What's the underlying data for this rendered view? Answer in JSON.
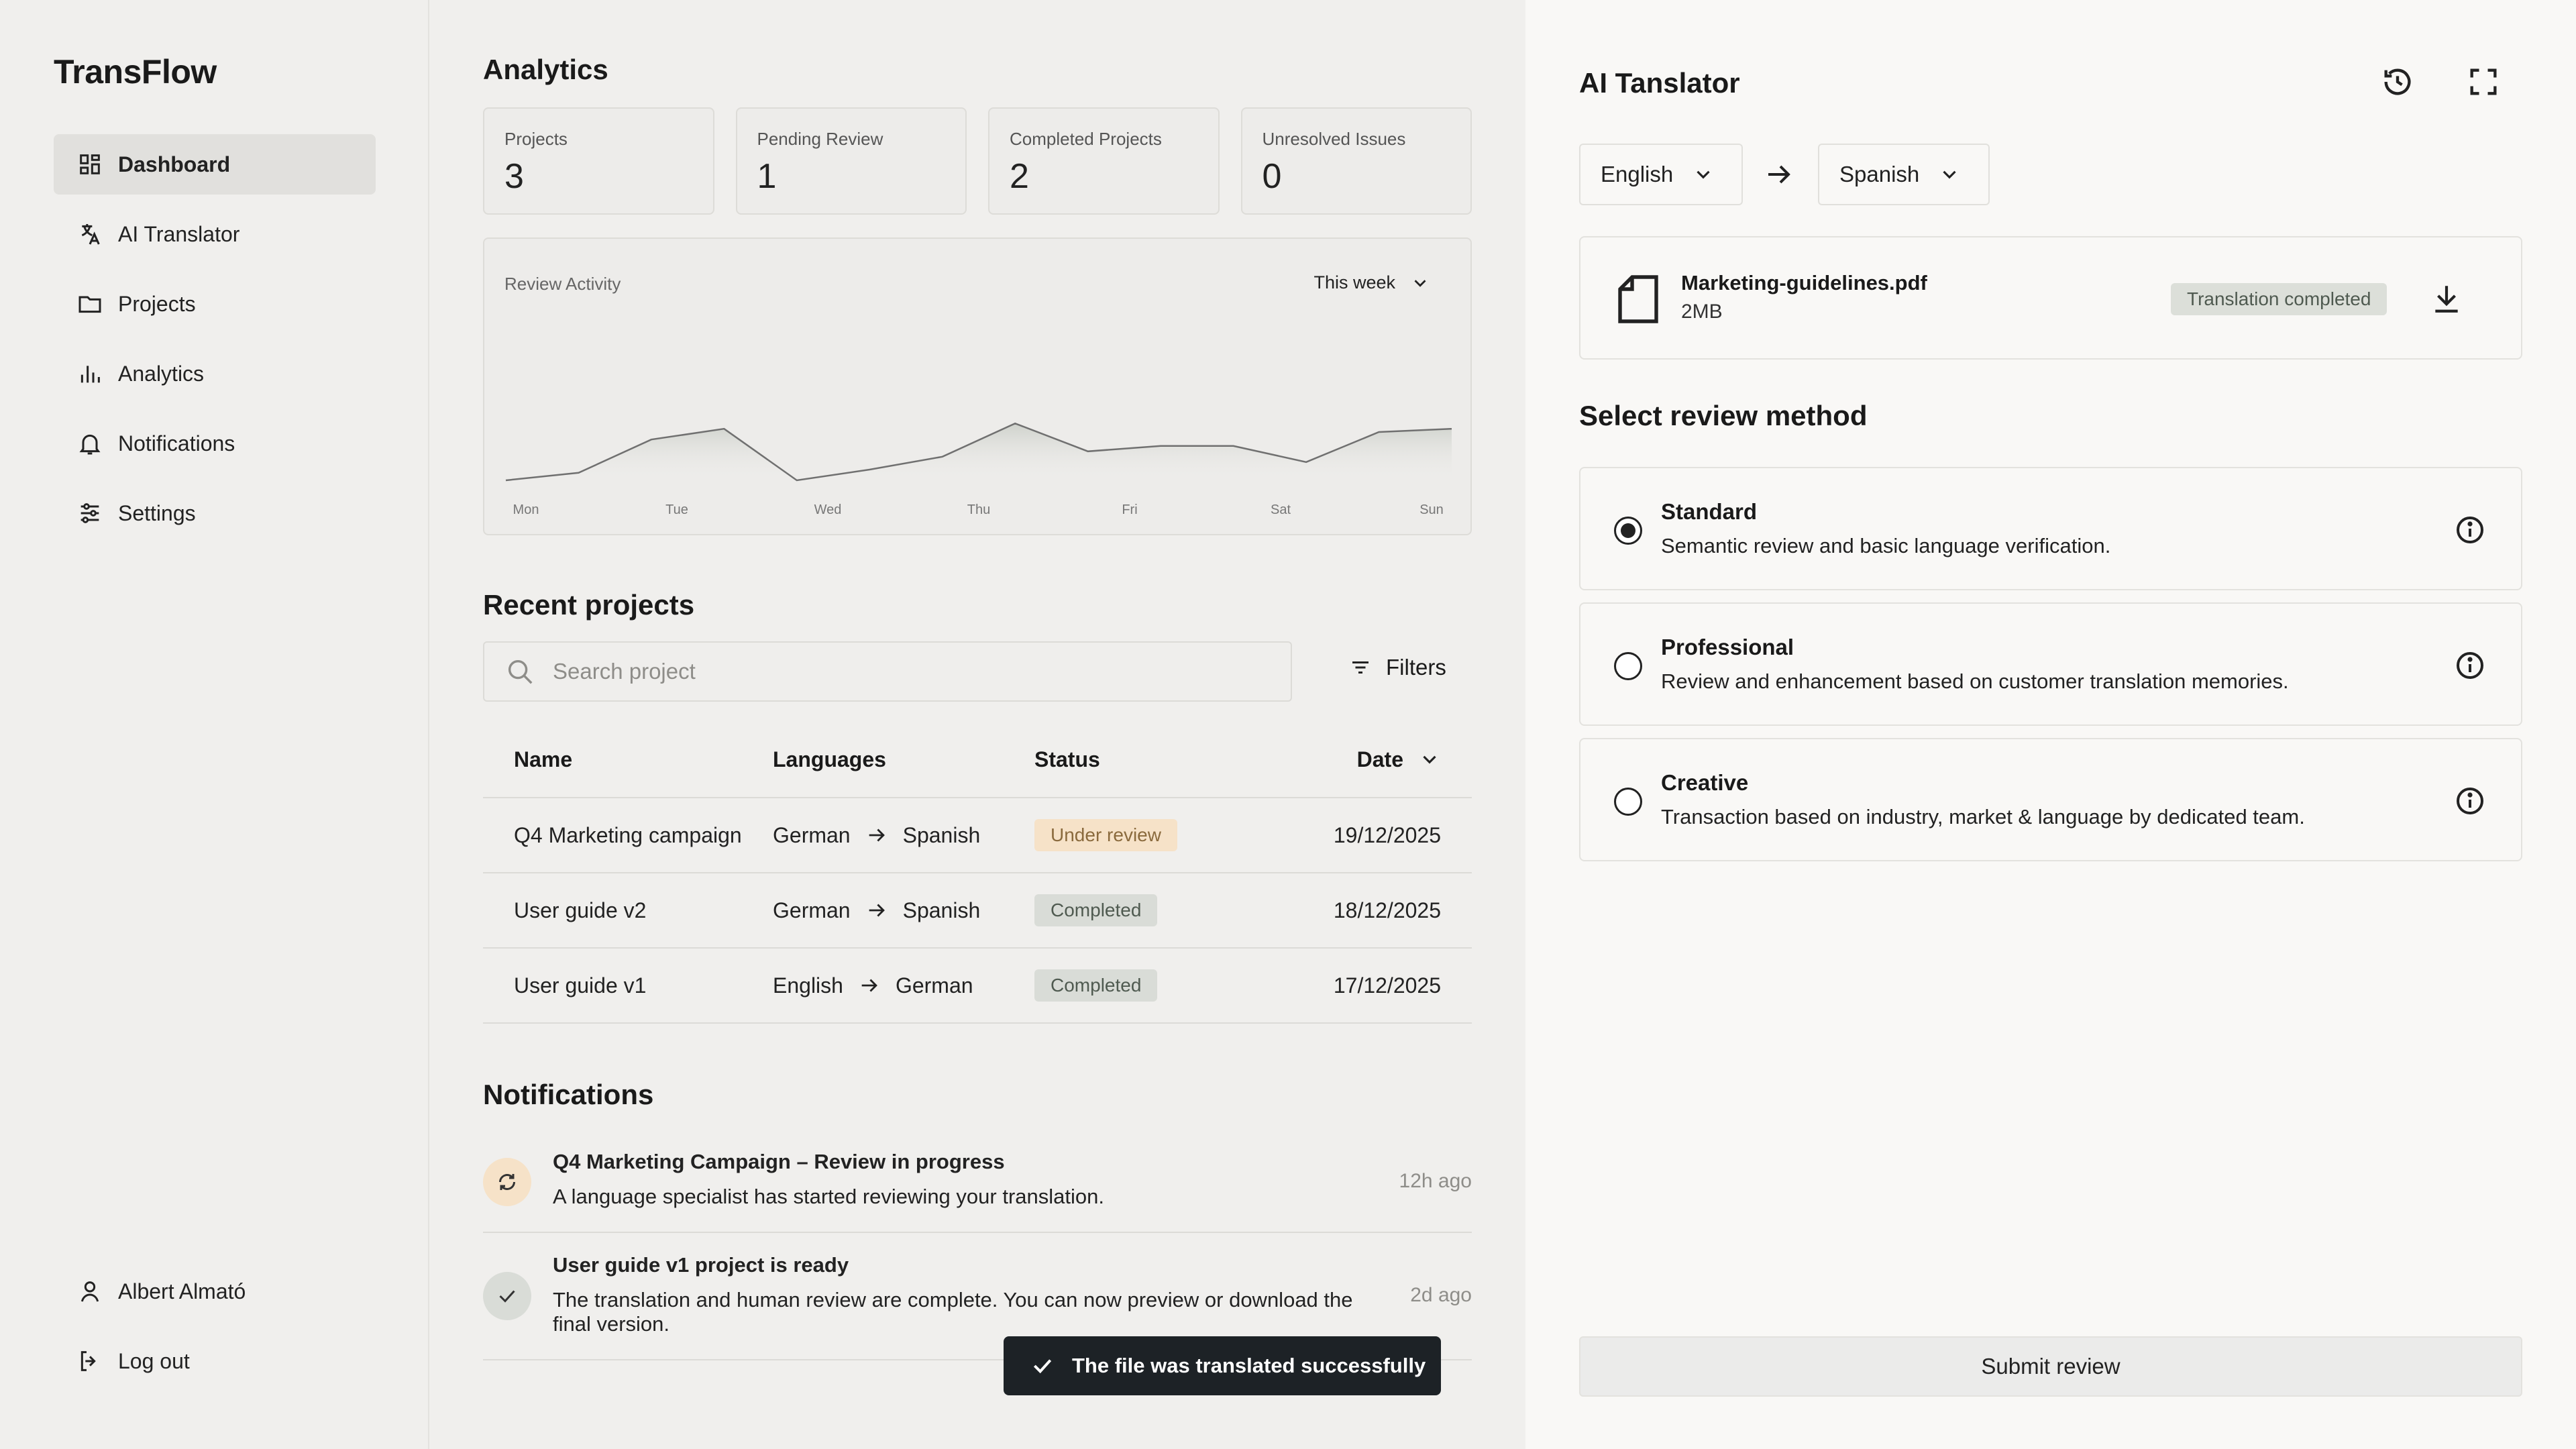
{
  "sidebar": {
    "brand": "TransFlow",
    "items": [
      {
        "label": "Dashboard",
        "icon": "dashboard-icon",
        "active": true
      },
      {
        "label": "AI Translator",
        "icon": "translate-icon"
      },
      {
        "label": "Projects",
        "icon": "folder-icon"
      },
      {
        "label": "Analytics",
        "icon": "bar-chart-icon"
      },
      {
        "label": "Notifications",
        "icon": "bell-icon"
      },
      {
        "label": "Settings",
        "icon": "sliders-icon"
      }
    ],
    "user": "Albert Almató",
    "logout": "Log out"
  },
  "analytics": {
    "title": "Analytics",
    "stats": [
      {
        "label": "Projects",
        "value": "3"
      },
      {
        "label": "Pending Review",
        "value": "1"
      },
      {
        "label": "Completed Projects",
        "value": "2"
      },
      {
        "label": "Unresolved Issues",
        "value": "0"
      }
    ]
  },
  "chart_data": {
    "type": "area",
    "title": "Review Activity",
    "range_selector": "This week",
    "categories": [
      "Mon",
      "Tue",
      "Wed",
      "Thu",
      "Fri",
      "Sat",
      "Sun"
    ],
    "x": [
      0,
      0.5,
      1,
      1.5,
      2,
      2.5,
      3,
      3.5,
      4,
      4.5,
      5,
      5.5,
      6
    ],
    "values": [
      0.0,
      0.07,
      0.38,
      0.48,
      0.0,
      0.1,
      0.22,
      0.53,
      0.27,
      0.32,
      0.32,
      0.17,
      0.45,
      0.48
    ],
    "grid": false,
    "legend": "none",
    "color": "#707070"
  },
  "projects": {
    "title": "Recent projects",
    "search_placeholder": "Search project",
    "filters_label": "Filters",
    "columns": {
      "name": "Name",
      "languages": "Languages",
      "status": "Status",
      "date": "Date"
    },
    "rows": [
      {
        "name": "Q4 Marketing campaign",
        "from": "German",
        "to": "Spanish",
        "status": "Under review",
        "date": "19/12/2025"
      },
      {
        "name": "User guide v2",
        "from": "German",
        "to": "Spanish",
        "status": "Completed",
        "date": "18/12/2025"
      },
      {
        "name": "User guide v1",
        "from": "English",
        "to": "German",
        "status": "Completed",
        "date": "17/12/2025"
      }
    ]
  },
  "notifications": {
    "title": "Notifications",
    "items": [
      {
        "title": "Q4 Marketing Campaign – Review in progress",
        "body": "A language specialist has started reviewing your translation.",
        "time": "12h ago"
      },
      {
        "title": "User guide v1 project is ready",
        "body": "The translation and human review are complete. You can now preview or download the final version.",
        "time": "2d ago"
      }
    ]
  },
  "toast": {
    "message": "The file was translated successfully"
  },
  "translator": {
    "title": "AI Tanslator",
    "source_lang": "English",
    "target_lang": "Spanish",
    "file": {
      "name": "Marketing-guidelines.pdf",
      "size": "2MB",
      "status": "Translation completed"
    },
    "method_heading": "Select review method",
    "methods": [
      {
        "title": "Standard",
        "desc": "Semantic review and basic language verification.",
        "selected": true
      },
      {
        "title": "Professional",
        "desc": "Review and enhancement based on customer translation memories."
      },
      {
        "title": "Creative",
        "desc": "Transaction based on industry, market & language by dedicated team."
      }
    ],
    "submit": "Submit review"
  },
  "colors": {
    "sidebar_bg": "#f0efed",
    "panel_bg": "#f9f8f6",
    "badge_review_bg": "#f6e2c8",
    "badge_done_bg": "#d9dcd7",
    "toast_bg": "#1d2226"
  }
}
